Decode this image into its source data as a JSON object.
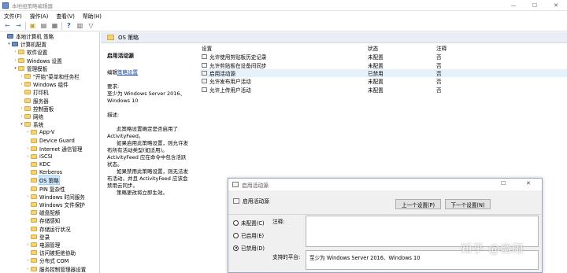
{
  "window": {
    "title": "本地组策略编辑器",
    "controls": [
      "—",
      "☐",
      "✕"
    ]
  },
  "menu": [
    "文件(F)",
    "操作(A)",
    "查看(V)",
    "帮助(H)"
  ],
  "tree": {
    "items": [
      {
        "label": "本地计算机 策略",
        "expander": "",
        "icon": "computer-policy-icon"
      },
      {
        "label": "计算机配置",
        "expander": "▾",
        "icon": "computer-icon"
      },
      {
        "label": "软件设置",
        "expander": "›",
        "icon": "folder-icon"
      },
      {
        "label": "Windows 设置",
        "expander": "›",
        "icon": "folder-icon"
      },
      {
        "label": "管理模板",
        "expander": "▾",
        "icon": "folder-icon"
      },
      {
        "label": "\"开始\"菜单和任务栏",
        "expander": "›",
        "icon": "folder-icon"
      },
      {
        "label": "Windows 组件",
        "expander": "›",
        "icon": "folder-icon"
      },
      {
        "label": "打印机",
        "expander": "",
        "icon": "folder-icon"
      },
      {
        "label": "服务器",
        "expander": "",
        "icon": "folder-icon"
      },
      {
        "label": "控制面板",
        "expander": "›",
        "icon": "folder-icon"
      },
      {
        "label": "网络",
        "expander": "›",
        "icon": "folder-icon"
      },
      {
        "label": "系统",
        "expander": "▾",
        "icon": "folder-icon"
      },
      {
        "label": "App-V",
        "expander": "›",
        "icon": "folder-icon"
      },
      {
        "label": "Device Guard",
        "expander": "",
        "icon": "folder-icon"
      },
      {
        "label": "Internet 通信管理",
        "expander": "›",
        "icon": "folder-icon"
      },
      {
        "label": "iSCSI",
        "expander": "›",
        "icon": "folder-icon"
      },
      {
        "label": "KDC",
        "expander": "",
        "icon": "folder-icon"
      },
      {
        "label": "Kerberos",
        "expander": "",
        "icon": "folder-icon"
      },
      {
        "label": "OS 策略",
        "expander": "",
        "icon": "folder-icon",
        "selected": true
      },
      {
        "label": "PIN 复杂性",
        "expander": "",
        "icon": "folder-icon"
      },
      {
        "label": "Windows 时间服务",
        "expander": "›",
        "icon": "folder-icon"
      },
      {
        "label": "Windows 文件保护",
        "expander": "",
        "icon": "folder-icon"
      },
      {
        "label": "磁盘配额",
        "expander": "",
        "icon": "folder-icon"
      },
      {
        "label": "存储感知",
        "expander": "",
        "icon": "folder-icon"
      },
      {
        "label": "存储运行状况",
        "expander": "",
        "icon": "folder-icon"
      },
      {
        "label": "登录",
        "expander": "",
        "icon": "folder-icon"
      },
      {
        "label": "电源管理",
        "expander": "›",
        "icon": "folder-icon"
      },
      {
        "label": "访问被拒绝协助",
        "expander": "",
        "icon": "folder-icon"
      },
      {
        "label": "分布式 COM",
        "expander": "›",
        "icon": "folder-icon"
      },
      {
        "label": "服务控制管理器设置",
        "expander": "›",
        "icon": "folder-icon"
      }
    ]
  },
  "content": {
    "header": "OS 策略",
    "description": {
      "title": "启用活动源",
      "edit_prefix": "编辑",
      "edit_link": "策略设置",
      "req_label": "要求:",
      "req_text": "至少为 Windows Server 2016、Windows 10",
      "desc_label": "描述:",
      "paras": [
        "此策略设置确定是否启用了 ActivityFeed。",
        "如果启用此策略设置，则允许发布所有活动类型(如适用)。ActivityFeed 应在命令中包含活跃状态。",
        "如果禁用此策略设置，则无法发布活动，并且 ActivityFeed 应该会禁用云同步。",
        "策略更改将立即生效。"
      ]
    },
    "columns": [
      "设置",
      "状态",
      "注释"
    ],
    "rows": [
      {
        "setting": "允许使用剪贴板历史记录",
        "state": "未配置",
        "note": "否"
      },
      {
        "setting": "允许剪贴板在设备间同步",
        "state": "未配置",
        "note": "否"
      },
      {
        "setting": "启用活动源",
        "state": "已禁用",
        "note": "否",
        "selected": true
      },
      {
        "setting": "允许发布用户活动",
        "state": "未配置",
        "note": "否"
      },
      {
        "setting": "允许上传用户活动",
        "state": "未配置",
        "note": "否"
      }
    ]
  },
  "dialog": {
    "title": "启用活动源",
    "subtitle": "启用活动源",
    "prev_button": "上一个设置(P)",
    "next_button": "下一个设置(N)",
    "options": [
      {
        "label": "未配置(C)",
        "checked": false
      },
      {
        "label": "已启用(E)",
        "checked": false
      },
      {
        "label": "已禁用(D)",
        "checked": true
      }
    ],
    "note_label": "注释:",
    "support_label": "支持的平台:",
    "support_text": "至少为 Windows Server 2016、Windows 10"
  },
  "watermark": "知乎 @幽雨"
}
